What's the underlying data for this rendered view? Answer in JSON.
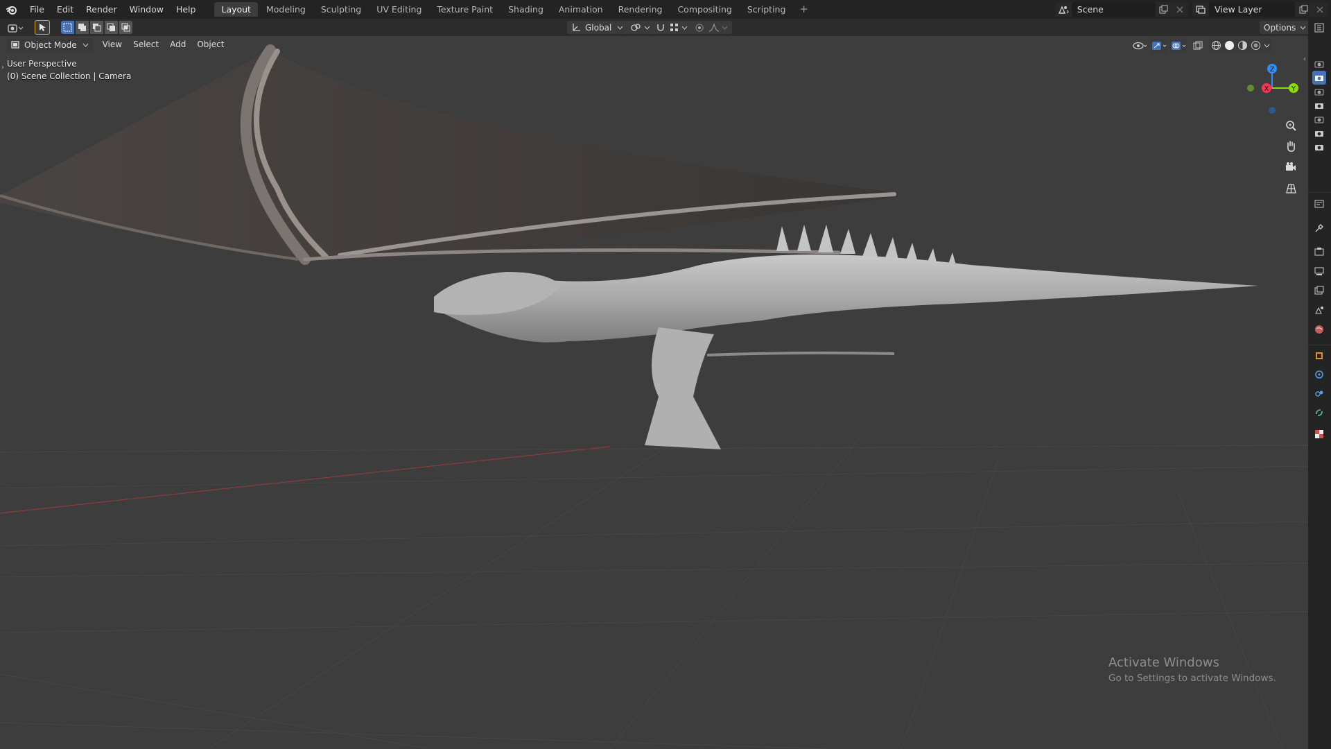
{
  "menus": [
    "File",
    "Edit",
    "Render",
    "Window",
    "Help"
  ],
  "workspaces": [
    "Layout",
    "Modeling",
    "Sculpting",
    "UV Editing",
    "Texture Paint",
    "Shading",
    "Animation",
    "Rendering",
    "Compositing",
    "Scripting"
  ],
  "active_workspace": "Layout",
  "add_workspace": "+",
  "scene": {
    "value": "Scene"
  },
  "view_layer": {
    "value": "View Layer"
  },
  "header2": {
    "orientation": "Global"
  },
  "viewport": {
    "mode": "Object Mode",
    "menus": [
      "View",
      "Select",
      "Add",
      "Object"
    ],
    "options_label": "Options",
    "info_line1": "User Perspective",
    "info_line2": "(0) Scene Collection | Camera",
    "gizmo": {
      "x": "X",
      "y": "Y",
      "z": "Z"
    }
  },
  "watermark": {
    "title": "Activate Windows",
    "subtitle": "Go to Settings to activate Windows."
  },
  "colors": {
    "accent": "#4772b3",
    "axis_x": "#ff3352",
    "axis_y": "#8bdc00",
    "axis_z": "#2890ff",
    "viewport_bg": "#3d3d3d"
  }
}
